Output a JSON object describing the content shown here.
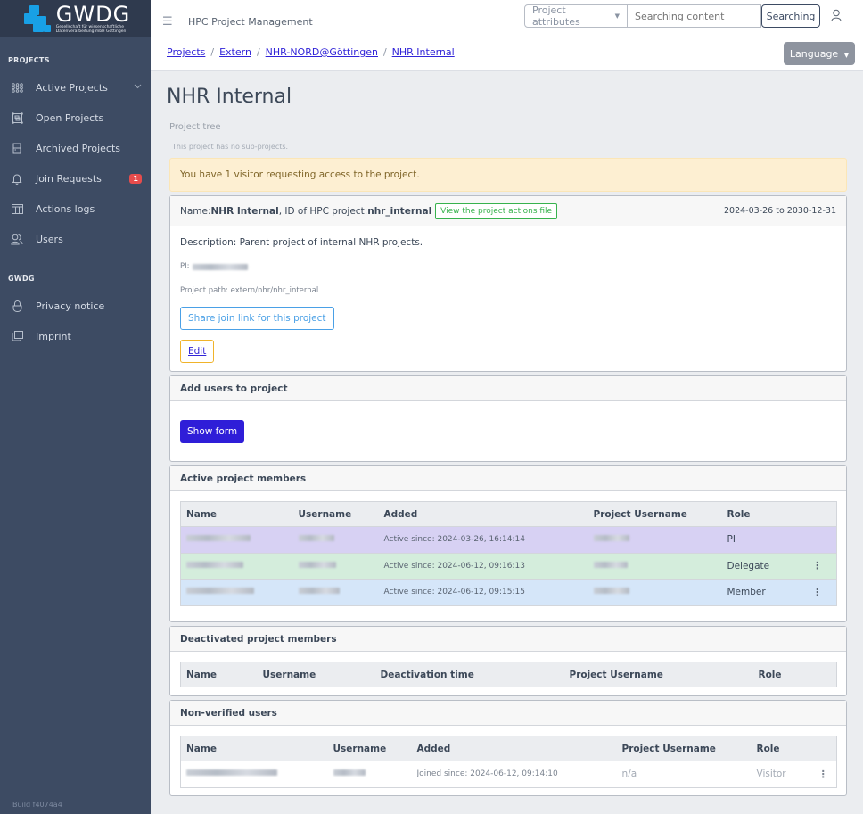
{
  "brand": {
    "logo_word": "GWDG",
    "logo_sub_line1": "Gesellschaft für wissenschaftliche",
    "logo_sub_line2": "Datenverarbeitung mbH Göttingen"
  },
  "sidebar": {
    "sections": [
      {
        "title": "PROJECTS",
        "items": [
          {
            "label": "Active Projects",
            "icon": "grid-dots-icon",
            "has_chevron": true
          },
          {
            "label": "Open Projects",
            "icon": "open-box-icon"
          },
          {
            "label": "Archived Projects",
            "icon": "archive-icon"
          },
          {
            "label": "Join Requests",
            "icon": "bell-icon",
            "badge": "1"
          },
          {
            "label": "Actions logs",
            "icon": "table-log-icon"
          },
          {
            "label": "Users",
            "icon": "users-icon"
          }
        ]
      },
      {
        "title": "GWDG",
        "items": [
          {
            "label": "Privacy notice",
            "icon": "lock-icon"
          },
          {
            "label": "Imprint",
            "icon": "copy-pages-icon"
          }
        ]
      }
    ],
    "build": "Build f4074a4"
  },
  "topbar": {
    "menu_icon": "hamburger-icon",
    "app_title": "HPC Project Management",
    "attr_select": "Project attributes",
    "search_placeholder": "Searching content",
    "search_button": "Searching",
    "language_button": "Language"
  },
  "breadcrumb": [
    "Projects",
    "Extern",
    "NHR-NORD@Göttingen",
    "NHR Internal"
  ],
  "page": {
    "title": "NHR Internal",
    "tree_label": "Project tree",
    "tree_note": "This project has no sub-projects.",
    "alert": "You have 1 visitor requesting access to the project."
  },
  "project": {
    "name_label": "Name: ",
    "name": "NHR Internal",
    "id_label": ", ID of HPC project: ",
    "id": "nhr_internal",
    "actions_file_button": "View the project actions file",
    "date_range": "2024-03-26 to 2030-12-31",
    "description": "Description: Parent project of internal NHR projects.",
    "pi_label": "PI:",
    "path": "Project path: extern/nhr/nhr_internal",
    "share_button": "Share join link for this project",
    "edit_button": "Edit"
  },
  "add_users": {
    "title": "Add users to project",
    "show_form_button": "Show form"
  },
  "active_members": {
    "title": "Active project members",
    "columns": [
      "Name",
      "Username",
      "Added",
      "Project Username",
      "Role"
    ],
    "rows": [
      {
        "added": "Active since: 2024-03-26, 16:14:14",
        "role": "PI",
        "menu": false
      },
      {
        "added": "Active since: 2024-06-12, 09:16:13",
        "role": "Delegate",
        "menu": true
      },
      {
        "added": "Active since: 2024-06-12, 09:15:15",
        "role": "Member",
        "menu": true
      }
    ]
  },
  "deactivated_members": {
    "title": "Deactivated project members",
    "columns": [
      "Name",
      "Username",
      "Deactivation time",
      "Project Username",
      "Role"
    ]
  },
  "non_verified": {
    "title": "Non-verified users",
    "columns": [
      "Name",
      "Username",
      "Added",
      "Project Username",
      "Role"
    ],
    "rows": [
      {
        "added": "Joined since: 2024-06-12, 09:14:10",
        "project_username": "n/a",
        "role": "Visitor"
      }
    ]
  },
  "colors": {
    "sidebar_bg": "#3d4b63",
    "accent": "#2f1ed8",
    "link": "#3124d8",
    "alert_bg": "#fdefd2",
    "pi_row": "#d7d1f3",
    "delegate_row": "#d4eddc",
    "member_row": "#d5e6f9",
    "badge": "#e74c4c"
  }
}
